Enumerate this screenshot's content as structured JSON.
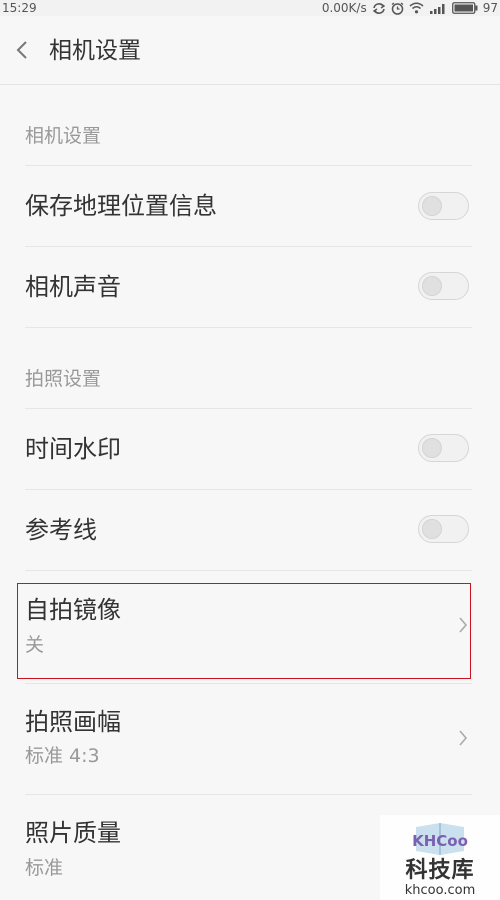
{
  "status_bar": {
    "time": "15:29",
    "net_speed": "0.00K/s",
    "battery_level": "97",
    "icons": [
      "sync-icon",
      "alarm-icon",
      "wifi-icon",
      "signal-icon",
      "battery-icon"
    ]
  },
  "header": {
    "title": "相机设置",
    "back_icon": "chevron-left-icon"
  },
  "sections": {
    "camera": {
      "header": "相机设置",
      "save_location": {
        "label": "保存地理位置信息",
        "enabled": false
      },
      "camera_sound": {
        "label": "相机声音",
        "enabled": false
      }
    },
    "photo": {
      "header": "拍照设置",
      "time_watermark": {
        "label": "时间水印",
        "enabled": false
      },
      "grid_lines": {
        "label": "参考线",
        "enabled": false
      },
      "selfie_mirror": {
        "label": "自拍镜像",
        "value": "关"
      },
      "aspect_ratio": {
        "label": "拍照画幅",
        "value": "标准 4:3"
      },
      "photo_quality": {
        "label": "照片质量",
        "value": "标准"
      }
    }
  },
  "watermark": {
    "logo_text": "KHCoo",
    "name": "科技库",
    "url": "khcoo.com"
  },
  "colors": {
    "background": "#f7f7f7",
    "highlight": "#c8141e",
    "primary_text": "#333333",
    "secondary_text": "#999999"
  }
}
